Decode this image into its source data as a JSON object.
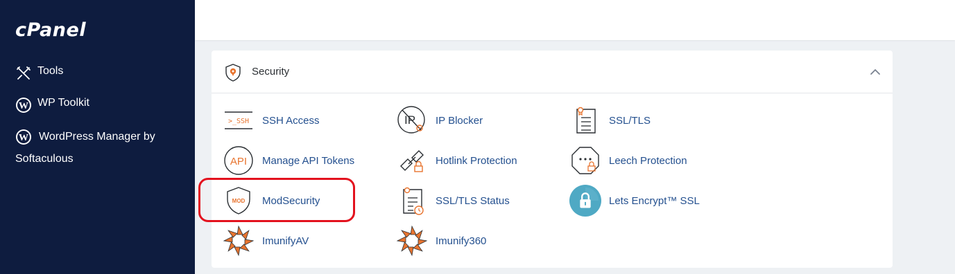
{
  "brand": {
    "logo": "cPanel"
  },
  "sidebar": {
    "items": [
      {
        "label": "Tools",
        "icon": "tools-icon"
      },
      {
        "label": "WP Toolkit",
        "icon": "wordpress-icon"
      },
      {
        "label_line1": "WordPress Manager by",
        "label_line2": "Softaculous",
        "icon": "wordpress-icon"
      }
    ]
  },
  "section": {
    "title": "Security",
    "icon": "security-shield-icon",
    "collapse_icon": "chevron-up-icon",
    "items": [
      {
        "label": "SSH Access",
        "icon": "ssh-icon"
      },
      {
        "label": "IP Blocker",
        "icon": "ip-blocker-icon"
      },
      {
        "label": "SSL/TLS",
        "icon": "ssl-tls-icon"
      },
      {
        "label": "Manage API Tokens",
        "icon": "api-icon"
      },
      {
        "label": "Hotlink Protection",
        "icon": "hotlink-icon"
      },
      {
        "label": "Leech Protection",
        "icon": "leech-icon"
      },
      {
        "label": "ModSecurity",
        "icon": "modsecurity-icon",
        "icon_text": "MOD"
      },
      {
        "label": "SSL/TLS Status",
        "icon": "ssl-status-icon"
      },
      {
        "label": "Lets Encrypt™ SSL",
        "icon": "lets-encrypt-icon"
      },
      {
        "label": "ImunifyAV",
        "icon": "imunify-icon"
      },
      {
        "label": "Imunify360",
        "icon": "imunify360-icon"
      }
    ]
  },
  "icon_texts": {
    "ssh": ">_SSH",
    "ip": "IP",
    "api": "API"
  },
  "colors": {
    "sidebar_bg": "#0e1c3f",
    "link": "#24508f",
    "accent_orange": "#e8742f",
    "highlight": "#e3121e",
    "teal": "#4fa9c4"
  }
}
